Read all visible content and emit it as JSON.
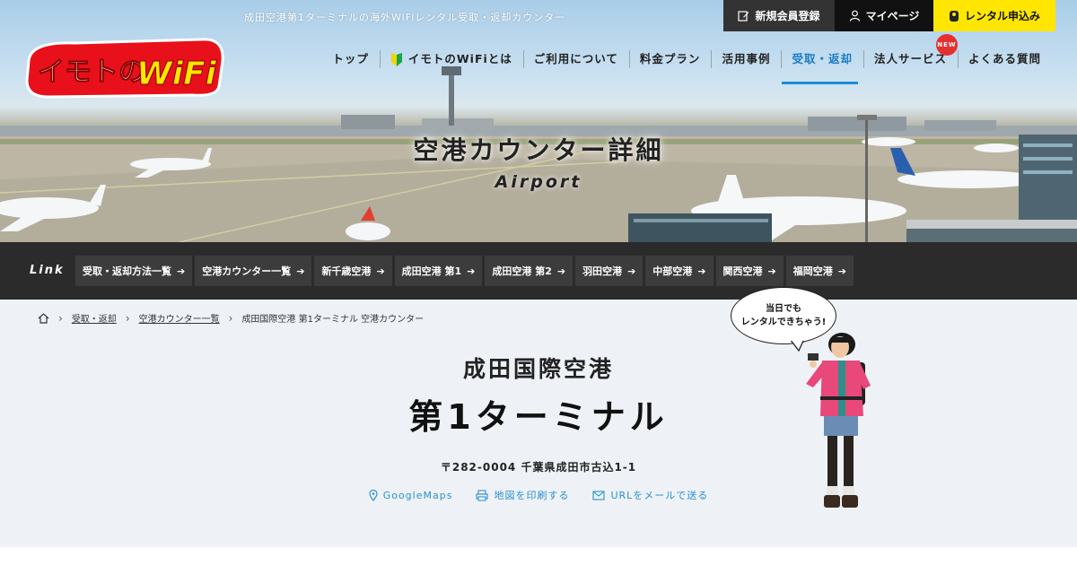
{
  "header": {
    "tagline": "成田空港第1ターミナルの海外WiFiレンタル受取・返却カウンター",
    "logo_text": "イモトのWiFi",
    "top_buttons": {
      "register": "新規会員登録",
      "mypage": "マイページ",
      "rental": "レンタル申込み"
    },
    "nav": [
      {
        "label": "トップ"
      },
      {
        "label": "イモトのWiFiとは"
      },
      {
        "label": "ご利用について"
      },
      {
        "label": "料金プラン"
      },
      {
        "label": "活用事例"
      },
      {
        "label": "受取・返却"
      },
      {
        "label": "法人サービス"
      },
      {
        "label": "よくある質問"
      }
    ],
    "new_badge": "NEW",
    "active_nav": "受取・返却",
    "accent_color": "#1a8fd6",
    "rental_color": "#ffe600"
  },
  "hero": {
    "title": "空港カウンター詳細",
    "subtitle": "Airport"
  },
  "linkbar": {
    "label": "Link",
    "items": [
      {
        "label": "受取・返却方法一覧"
      },
      {
        "label": "空港カウンター一覧"
      },
      {
        "label": "新千歳空港"
      },
      {
        "label": "成田空港 第1"
      },
      {
        "label": "成田空港 第2"
      },
      {
        "label": "羽田空港"
      },
      {
        "label": "中部空港"
      },
      {
        "label": "関西空港"
      },
      {
        "label": "福岡空港"
      }
    ]
  },
  "breadcrumb": {
    "home_icon": "home-icon",
    "items": [
      "受取・返却",
      "空港カウンター一覧",
      "成田国際空港 第1ターミナル 空港カウンター"
    ]
  },
  "main": {
    "airport": "成田国際空港",
    "terminal": "第1ターミナル",
    "address": "〒282-0004 千葉県成田市古込1-1",
    "actions": [
      {
        "label": "GoogleMaps",
        "icon": "map-pin-icon"
      },
      {
        "label": "地図を印刷する",
        "icon": "printer-icon"
      },
      {
        "label": "URLをメールで送る",
        "icon": "mail-icon"
      }
    ],
    "bubble_line1": "当日でも",
    "bubble_line2": "レンタルできちゃう!"
  }
}
